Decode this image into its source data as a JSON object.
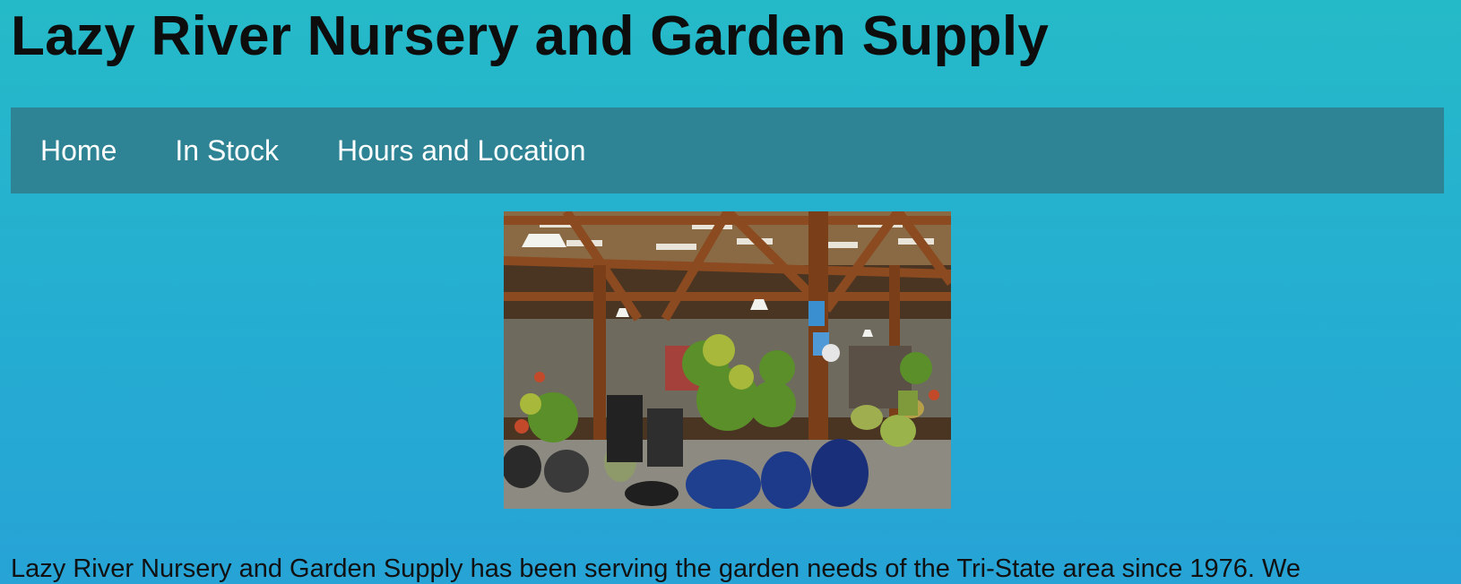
{
  "header": {
    "title": "Lazy River Nursery and Garden Supply"
  },
  "nav": {
    "items": [
      {
        "label": "Home"
      },
      {
        "label": "In Stock"
      },
      {
        "label": "Hours and Location"
      }
    ]
  },
  "hero": {
    "image_description": "garden-center-photo"
  },
  "main": {
    "intro": "Lazy River Nursery and Garden Supply has been serving the garden needs of the Tri-State area since 1976. We"
  },
  "colors": {
    "background": "#25b3cf",
    "nav_background": "#2e8494",
    "nav_text": "#ffffff",
    "title_text": "#0d0d0d"
  }
}
